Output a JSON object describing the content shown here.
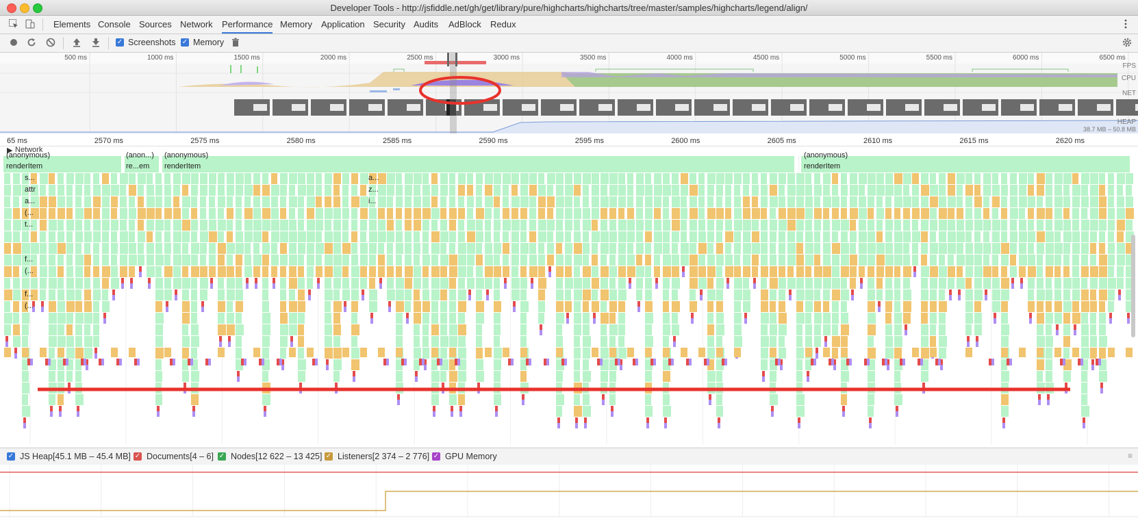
{
  "window": {
    "title": "Developer Tools - http://jsfiddle.net/gh/get/library/pure/highcharts/highcharts/tree/master/samples/highcharts/legend/align/"
  },
  "tabs": [
    {
      "label": "Elements",
      "active": false
    },
    {
      "label": "Console",
      "active": false
    },
    {
      "label": "Sources",
      "active": false
    },
    {
      "label": "Network",
      "active": false
    },
    {
      "label": "Performance",
      "active": true
    },
    {
      "label": "Memory",
      "active": false
    },
    {
      "label": "Application",
      "active": false
    },
    {
      "label": "Security",
      "active": false
    },
    {
      "label": "Audits",
      "active": false
    },
    {
      "label": "AdBlock",
      "active": false
    },
    {
      "label": "Redux",
      "active": false
    }
  ],
  "toolbar": {
    "screenshots_label": "Screenshots",
    "screenshots_checked": true,
    "memory_label": "Memory",
    "memory_checked": true
  },
  "overview": {
    "ticks": [
      "500 ms",
      "1000 ms",
      "1500 ms",
      "2000 ms",
      "2500 ms",
      "3000 ms",
      "3500 ms",
      "4000 ms",
      "4500 ms",
      "5000 ms",
      "5500 ms",
      "6000 ms",
      "6500 ms"
    ],
    "tracks": {
      "fps": "FPS",
      "cpu": "CPU",
      "net": "NET",
      "heap": "HEAP"
    },
    "heap_range": "38.7 MB – 50.8 MB"
  },
  "main": {
    "ticks": [
      "65 ms",
      "2570 ms",
      "2575 ms",
      "2580 ms",
      "2585 ms",
      "2590 ms",
      "2595 ms",
      "2600 ms",
      "2605 ms",
      "2610 ms",
      "2615 ms",
      "2620 ms"
    ],
    "network_label": "Network",
    "flame_labels": {
      "top_a": "(anonymous)",
      "top_b": "(anon...)",
      "top_c": "(anonymous)",
      "top_d": "(anonymous)",
      "render_a": "renderItem",
      "render_b": "re...em",
      "render_c": "renderItem",
      "render_d": "renderItem",
      "l_s": "s...",
      "l_attr": "attr",
      "l_a": "a...",
      "l_p1": "(...",
      "l_t": "t...",
      "l_f1": "f...",
      "l_p2": "(...",
      "l_f2": "f...",
      "l_p3": "(...",
      "m_a": "a...",
      "m_z": "z...",
      "m_i": "i..."
    }
  },
  "memory_legend": {
    "js_heap": "JS Heap[45.1 MB – 45.4 MB]",
    "documents": "Documents[4 – 6]",
    "nodes": "Nodes[12 622 – 13 425]",
    "listeners": "Listeners[2 374 – 2 776]",
    "gpu_memory": "GPU Memory"
  },
  "colors": {
    "accent": "#3879d9",
    "scripting": "#f1c46f",
    "rendering": "#b9f3c9",
    "painting": "#ae8ef3",
    "annotation": "#e8322b"
  }
}
